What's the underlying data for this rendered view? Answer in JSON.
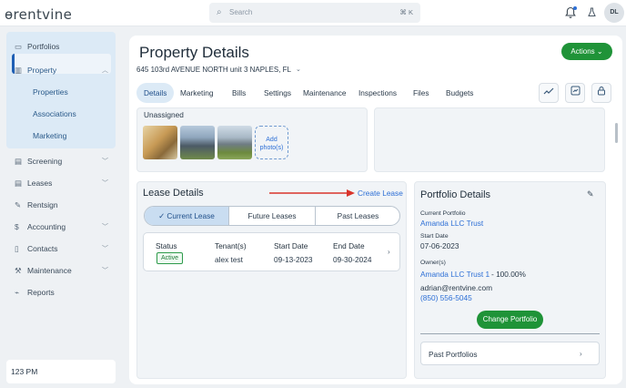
{
  "topbar": {
    "logo": "ɵrentvine",
    "search_placeholder": "Search",
    "search_shortcut": "⌘ K",
    "avatar_initials": "DL"
  },
  "sidebar": {
    "items": [
      {
        "label": "Portfolios",
        "icon": "folder-icon"
      },
      {
        "label": "Property",
        "icon": "building-icon"
      },
      {
        "label": "Screening",
        "icon": "screening-icon"
      },
      {
        "label": "Leases",
        "icon": "leases-icon"
      },
      {
        "label": "Rentsign",
        "icon": "rentsign-icon"
      },
      {
        "label": "Accounting",
        "icon": "dollar-icon"
      },
      {
        "label": "Contacts",
        "icon": "contacts-icon"
      },
      {
        "label": "Maintenance",
        "icon": "wrench-icon"
      },
      {
        "label": "Reports",
        "icon": "reports-icon"
      }
    ],
    "property_sub": [
      "Properties",
      "Associations",
      "Marketing"
    ],
    "footer": "123 PM"
  },
  "page": {
    "title": "Property Details",
    "actions_label": "Actions",
    "address": "645 103rd AVENUE NORTH unit 3 NAPLES, FL",
    "tabs": [
      "Details",
      "Marketing",
      "Bills",
      "Settings",
      "Maintenance",
      "Inspections",
      "Files",
      "Budgets"
    ],
    "unassigned": "Unassigned",
    "add_photo": "Add photo(s)"
  },
  "lease": {
    "title": "Lease Details",
    "create_label": "Create Lease",
    "segments": [
      "Current Lease",
      "Future Leases",
      "Past Leases"
    ],
    "headers": {
      "status": "Status",
      "tenants": "Tenant(s)",
      "start": "Start Date",
      "end": "End Date"
    },
    "row": {
      "status": "Active",
      "tenants": "alex test",
      "start": "09-13-2023",
      "end": "09-30-2024"
    }
  },
  "portfolio": {
    "title": "Portfolio Details",
    "current_label": "Current Portfolio",
    "current_value": "Amanda LLC Trust",
    "start_label": "Start Date",
    "start_value": "07-06-2023",
    "owners_label": "Owner(s)",
    "owner_name": "Amanda LLC Trust 1",
    "owner_pct": "-  100.00%",
    "email": "adrian@rentvine.com",
    "phone": "(850) 556-5045",
    "change_label": "Change Portfolio",
    "past_label": "Past Portfolios"
  },
  "colors": {
    "accent_green": "#1f9338",
    "link_blue": "#2d6fd6",
    "nav_active_bg": "#dceaf6",
    "arrow_red": "#d9342b"
  }
}
